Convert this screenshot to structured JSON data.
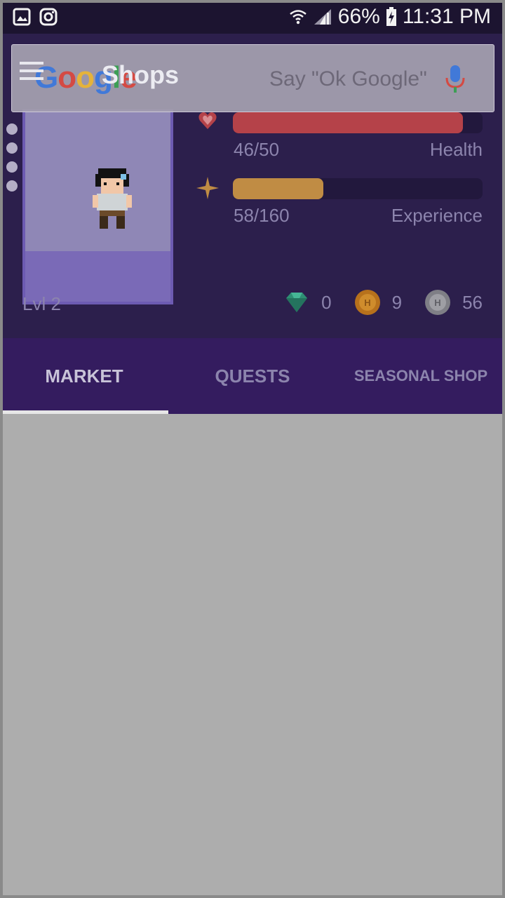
{
  "status_bar": {
    "battery": "66%",
    "time": "11:31 PM",
    "icons": [
      "gallery-icon",
      "instagram-icon",
      "wifi-icon",
      "signal-icon",
      "battery-charging-icon"
    ]
  },
  "google_bar": {
    "logo": [
      "G",
      "o",
      "o",
      "g",
      "l",
      "e"
    ],
    "hint": "Say \"Ok Google\""
  },
  "toolbar": {
    "title": "Shops"
  },
  "stats": {
    "health": {
      "value": "46/50",
      "label": "Health",
      "fraction": 0.92
    },
    "experience": {
      "value": "58/160",
      "label": "Experience",
      "fraction": 0.3625
    }
  },
  "level": "Lvl 2",
  "currencies": {
    "gems": "0",
    "gold": "9",
    "silver": "56"
  },
  "tabs": [
    {
      "label": "MARKET",
      "active": true
    },
    {
      "label": "QUESTS",
      "active": false
    },
    {
      "label": "SEASONAL SHOP",
      "active": false
    }
  ],
  "colors": {
    "header_bg": "#2c1f4c",
    "tabs_bg": "#341c5f",
    "health": "#b54249",
    "experience": "#c08c44"
  }
}
